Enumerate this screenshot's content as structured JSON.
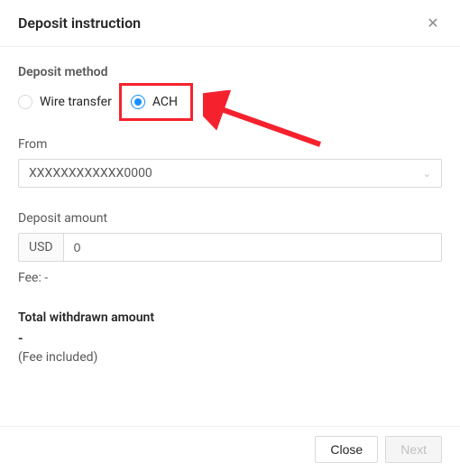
{
  "header": {
    "title": "Deposit instruction"
  },
  "method": {
    "label": "Deposit method",
    "options": {
      "wire": "Wire transfer",
      "ach": "ACH"
    },
    "selected": "ach"
  },
  "from": {
    "label": "From",
    "value": "XXXXXXXXXXXX0000"
  },
  "amount": {
    "label": "Deposit amount",
    "currency": "USD",
    "value": "0"
  },
  "fee": {
    "label": "Fee: -"
  },
  "total": {
    "label": "Total withdrawn amount",
    "value": "-",
    "note": "(Fee included)"
  },
  "footer": {
    "close": "Close",
    "next": "Next"
  }
}
